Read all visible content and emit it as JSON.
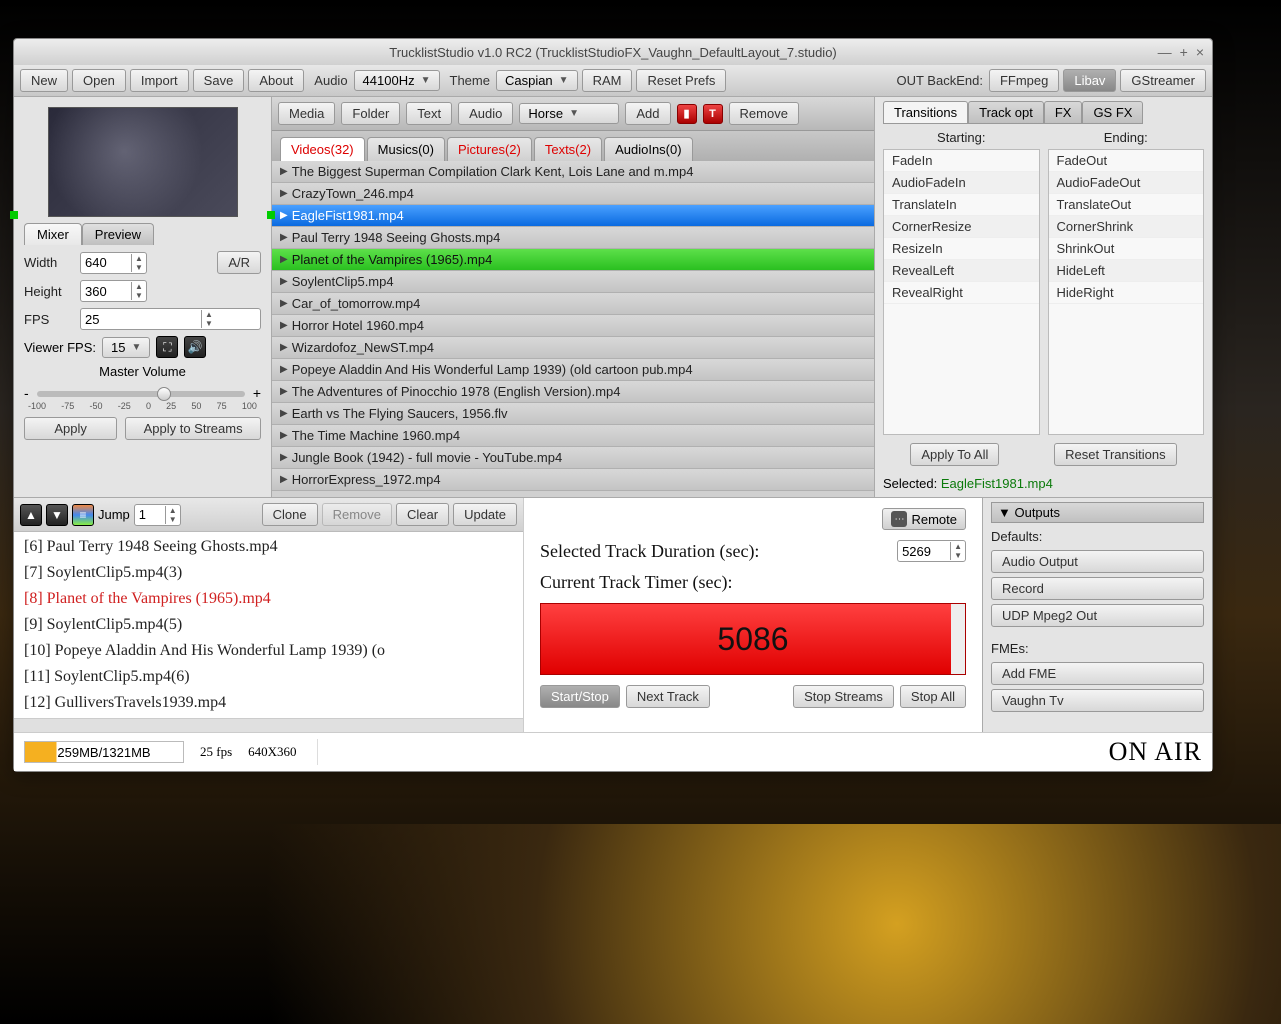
{
  "window": {
    "title": "TrucklistStudio v1.0 RC2 (TrucklistStudioFX_Vaughn_DefaultLayout_7.studio)"
  },
  "toolbar": {
    "new": "New",
    "open": "Open",
    "import": "Import",
    "save": "Save",
    "about": "About",
    "audio_label": "Audio",
    "audio_value": "44100Hz",
    "theme_label": "Theme",
    "theme_value": "Caspian",
    "ram": "RAM",
    "reset": "Reset Prefs",
    "backend_label": "OUT BackEnd:",
    "backends": {
      "ffmpeg": "FFmpeg",
      "libav": "Libav",
      "gstreamer": "GStreamer"
    }
  },
  "mixer": {
    "tabs": {
      "mixer": "Mixer",
      "preview": "Preview"
    },
    "width_label": "Width",
    "width_value": "640",
    "height_label": "Height",
    "height_value": "360",
    "ar_btn": "A/R",
    "fps_label": "FPS",
    "fps_value": "25",
    "viewer_label": "Viewer FPS:",
    "viewer_value": "15",
    "volume_label": "Master Volume",
    "vol_ticks": [
      "-100",
      "-75",
      "-50",
      "-25",
      "0",
      "25",
      "50",
      "75",
      "100"
    ],
    "apply": "Apply",
    "apply_streams": "Apply to Streams"
  },
  "media_toolbar": {
    "media": "Media",
    "folder": "Folder",
    "text": "Text",
    "audio": "Audio",
    "preset": "Horse",
    "add": "Add",
    "remove": "Remove",
    "t_icon": "T"
  },
  "file_tabs": {
    "videos": "Videos(32)",
    "musics": "Musics(0)",
    "pictures": "Pictures(2)",
    "texts": "Texts(2)",
    "audioins": "AudioIns(0)"
  },
  "files": [
    "The Biggest Superman Compilation Clark Kent, Lois Lane and m.mp4",
    "CrazyTown_246.mp4",
    "EagleFist1981.mp4",
    "Paul Terry 1948 Seeing Ghosts.mp4",
    "Planet of the Vampires (1965).mp4",
    "SoylentClip5.mp4",
    "Car_of_tomorrow.mp4",
    "Horror Hotel 1960.mp4",
    "Wizardofoz_NewST.mp4",
    "Popeye Aladdin And His Wonderful Lamp 1939) (old cartoon pub.mp4",
    "The Adventures of Pinocchio 1978 (English Version).mp4",
    "Earth vs The Flying Saucers, 1956.flv",
    "The Time Machine 1960.mp4",
    "Jungle Book (1942) - full movie - YouTube.mp4",
    "HorrorExpress_1972.mp4"
  ],
  "right_tabs": {
    "transitions": "Transitions",
    "trackopt": "Track opt",
    "fx": "FX",
    "gsfx": "GS FX"
  },
  "trans": {
    "start_hdr": "Starting:",
    "end_hdr": "Ending:",
    "starting": [
      "FadeIn",
      "AudioFadeIn",
      "TranslateIn",
      "CornerResize",
      "ResizeIn",
      "RevealLeft",
      "RevealRight"
    ],
    "ending": [
      "FadeOut",
      "AudioFadeOut",
      "TranslateOut",
      "CornerShrink",
      "ShrinkOut",
      "HideLeft",
      "HideRight"
    ],
    "apply_all": "Apply To All",
    "reset": "Reset Transitions",
    "selected_label": "Selected:",
    "selected_file": "EagleFist1981.mp4"
  },
  "queue_toolbar": {
    "jump": "Jump",
    "jump_val": "1",
    "clone": "Clone",
    "remove": "Remove",
    "clear": "Clear",
    "update": "Update"
  },
  "queue": [
    "[6] Paul Terry 1948 Seeing Ghosts.mp4",
    "[7] SoylentClip5.mp4(3)",
    "[8] Planet of the Vampires (1965).mp4",
    "[9] SoylentClip5.mp4(5)",
    "[10] Popeye Aladdin And His Wonderful Lamp 1939) (o",
    "[11] SoylentClip5.mp4(6)",
    "[12] GulliversTravels1939.mp4"
  ],
  "timer": {
    "remote": "Remote",
    "dur_label": "Selected Track Duration (sec):",
    "dur_value": "5269",
    "cur_label": "Current Track Timer (sec):",
    "cur_value": "5086",
    "start_stop": "Start/Stop",
    "next": "Next Track",
    "stop_streams": "Stop Streams",
    "stop_all": "Stop All"
  },
  "status": {
    "mem": "259MB/1321MB",
    "fps": "25 fps",
    "res": "640X360",
    "onair": "ON AIR"
  },
  "outputs": {
    "header": "▼ Outputs",
    "defaults": "Defaults:",
    "audio_out": "Audio Output",
    "record": "Record",
    "udp": "UDP Mpeg2 Out",
    "fmes": "FMEs:",
    "add_fme": "Add FME",
    "vaughn": "Vaughn Tv"
  }
}
